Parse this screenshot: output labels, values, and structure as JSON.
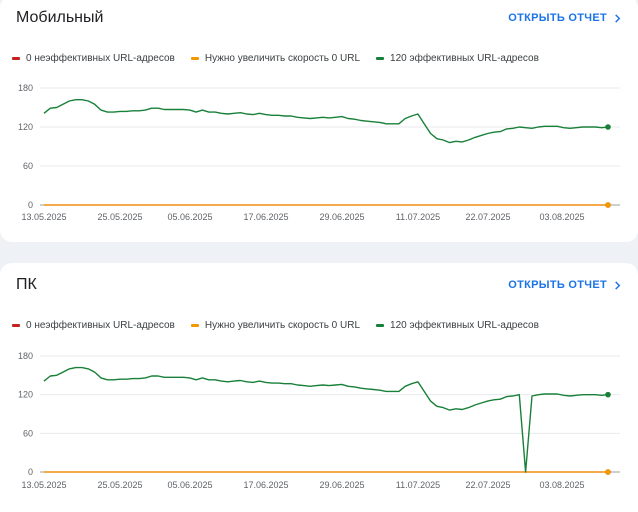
{
  "cards": [
    {
      "title": "Мобильный",
      "open_report_label": "ОТКРЫТЬ ОТЧЕТ",
      "legend": [
        {
          "label": "0 неэффективных URL-адресов",
          "color": "#c5221f"
        },
        {
          "label": "Нужно увеличить скорость 0 URL",
          "color": "#f29900"
        },
        {
          "label": "120 эффективных URL-адресов",
          "color": "#188038"
        }
      ]
    },
    {
      "title": "ПК",
      "open_report_label": "ОТКРЫТЬ ОТЧЕТ",
      "legend": [
        {
          "label": "0 неэффективных URL-адресов",
          "color": "#c5221f"
        },
        {
          "label": "Нужно увеличить скорость 0 URL",
          "color": "#f29900"
        },
        {
          "label": "120 эффективных URL-адресов",
          "color": "#188038"
        }
      ]
    }
  ],
  "chart_data": [
    {
      "type": "line",
      "x_tick_labels": [
        "13.05.2025",
        "25.05.2025",
        "05.06.2025",
        "17.06.2025",
        "29.06.2025",
        "11.07.2025",
        "22.07.2025",
        "03.08.2025"
      ],
      "y_ticks": [
        0,
        60,
        120,
        180
      ],
      "ylim": [
        0,
        180
      ],
      "grid": true,
      "legend_placement": "top-left",
      "series": [
        {
          "color": "#188038",
          "values": [
            141,
            149,
            150,
            155,
            160,
            162,
            162,
            160,
            155,
            146,
            143,
            143,
            144,
            144,
            145,
            145,
            146,
            149,
            149,
            147,
            147,
            147,
            147,
            146,
            143,
            146,
            143,
            143,
            141,
            140,
            141,
            142,
            140,
            139,
            141,
            139,
            138,
            138,
            137,
            137,
            135,
            134,
            133,
            134,
            135,
            134,
            135,
            136,
            133,
            132,
            130,
            129,
            128,
            127,
            125,
            125,
            125,
            133,
            137,
            140,
            125,
            110,
            102,
            100,
            96,
            98,
            97,
            100,
            104,
            107,
            110,
            112,
            113,
            117,
            118,
            120,
            119,
            118,
            120,
            121,
            121,
            121,
            119,
            118,
            119,
            120,
            120,
            120,
            119,
            120
          ]
        },
        {
          "color": "#f29900",
          "values": [
            0,
            0
          ]
        },
        {
          "color": "#c5221f",
          "values": [
            0,
            0
          ]
        }
      ]
    },
    {
      "type": "line",
      "x_tick_labels": [
        "13.05.2025",
        "25.05.2025",
        "05.06.2025",
        "17.06.2025",
        "29.06.2025",
        "11.07.2025",
        "22.07.2025",
        "03.08.2025"
      ],
      "y_ticks": [
        0,
        60,
        120,
        180
      ],
      "ylim": [
        0,
        180
      ],
      "grid": true,
      "legend_placement": "top-left",
      "series": [
        {
          "color": "#188038",
          "values": [
            141,
            149,
            150,
            155,
            160,
            162,
            162,
            160,
            155,
            146,
            143,
            143,
            144,
            144,
            145,
            145,
            146,
            149,
            149,
            147,
            147,
            147,
            147,
            146,
            143,
            146,
            143,
            143,
            141,
            140,
            141,
            142,
            140,
            139,
            141,
            139,
            138,
            138,
            137,
            137,
            135,
            134,
            133,
            134,
            135,
            134,
            135,
            136,
            133,
            132,
            130,
            129,
            128,
            127,
            125,
            125,
            125,
            133,
            137,
            140,
            125,
            110,
            102,
            100,
            96,
            98,
            97,
            100,
            104,
            107,
            110,
            112,
            113,
            117,
            118,
            120,
            0,
            118,
            120,
            121,
            121,
            121,
            119,
            118,
            119,
            120,
            120,
            120,
            119,
            120
          ]
        },
        {
          "color": "#f29900",
          "values": [
            0,
            0
          ]
        },
        {
          "color": "#c5221f",
          "values": [
            0,
            0
          ]
        }
      ]
    }
  ]
}
